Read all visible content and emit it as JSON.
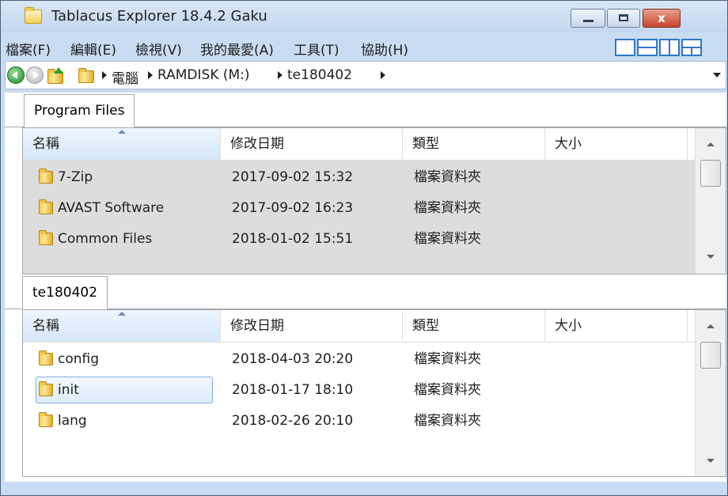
{
  "window": {
    "title": "Tablacus Explorer 18.4.2 Gaku",
    "close_glyph": "x"
  },
  "menu": [
    {
      "label": "檔案(F)"
    },
    {
      "label": "編輯(E)"
    },
    {
      "label": "檢視(V)"
    },
    {
      "label": "我的最愛(A)"
    },
    {
      "label": "工具(T)"
    },
    {
      "label": "協助(H)"
    }
  ],
  "layout_icons": [
    "single-pane-icon",
    "horizontal-split-icon",
    "vertical-split-icon",
    "four-pane-icon"
  ],
  "navbar": {
    "breadcrumbs": [
      "電腦",
      "RAMDISK (M:)",
      "te180402"
    ]
  },
  "pane_top": {
    "tab": "Program Files",
    "columns": [
      "名稱",
      "修改日期",
      "類型",
      "大小"
    ],
    "rows": [
      {
        "name": "7-Zip",
        "modified": "2017-09-02 15:32",
        "type": "檔案資料夾",
        "size": ""
      },
      {
        "name": "AVAST Software",
        "modified": "2017-09-02 16:23",
        "type": "檔案資料夾",
        "size": ""
      },
      {
        "name": "Common Files",
        "modified": "2018-01-02 15:51",
        "type": "檔案資料夾",
        "size": ""
      }
    ]
  },
  "pane_bottom": {
    "tab": "te180402",
    "columns": [
      "名稱",
      "修改日期",
      "類型",
      "大小"
    ],
    "rows": [
      {
        "name": "config",
        "modified": "2018-04-03 20:20",
        "type": "檔案資料夾",
        "size": ""
      },
      {
        "name": "init",
        "modified": "2018-01-17 18:10",
        "type": "檔案資料夾",
        "size": ""
      },
      {
        "name": "lang",
        "modified": "2018-02-26 20:10",
        "type": "檔案資料夾",
        "size": ""
      }
    ]
  },
  "colors": {
    "accent": "#2e78c8",
    "selection": "#dcebfc",
    "inactive_row": "#dddddd"
  }
}
